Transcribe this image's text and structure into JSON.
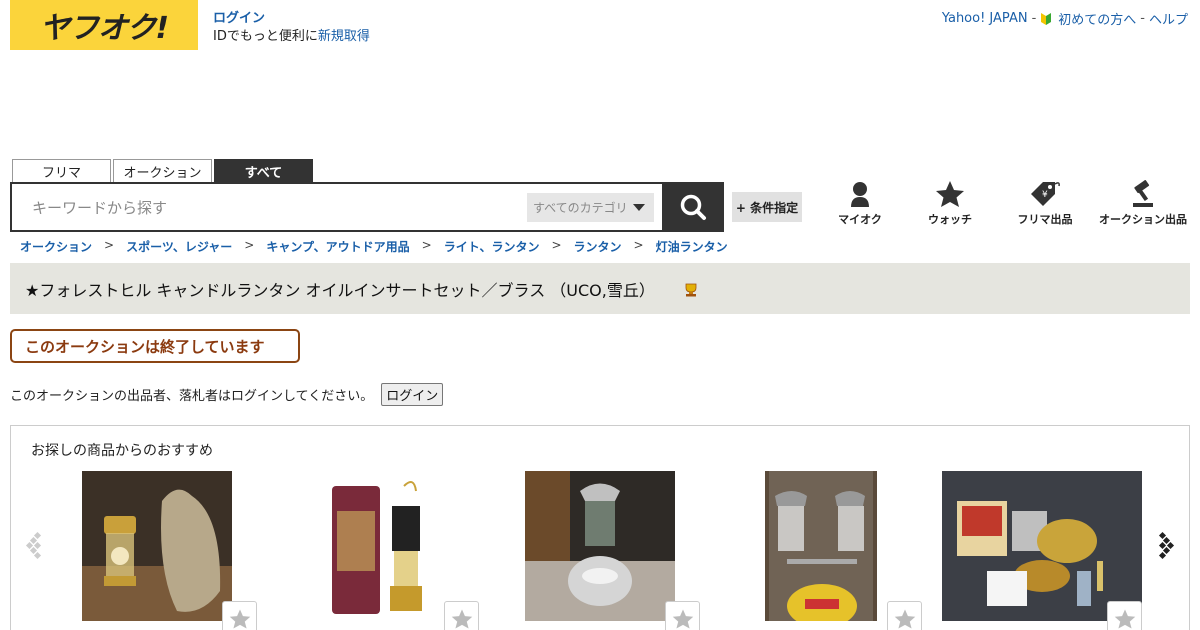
{
  "header": {
    "logo_text": "ヤフオク!",
    "login_link": "ログイン",
    "login_sub_prefix": "IDでもっと便利に",
    "signup_link": "新規取得",
    "top_links": [
      "Yahoo! JAPAN",
      "初めての方へ",
      "ヘルプ"
    ],
    "top_sep": "-"
  },
  "search": {
    "tabs": [
      "フリマ",
      "オークション",
      "すべて"
    ],
    "active_tab": "すべて",
    "placeholder": "キーワードから探す",
    "category": "すべてのカテゴリ",
    "condition_label": "+ 条件指定"
  },
  "nav": {
    "items": [
      {
        "label": "マイオク",
        "icon": "person-icon"
      },
      {
        "label": "ウォッチ",
        "icon": "star-icon"
      },
      {
        "label": "フリマ出品",
        "icon": "price-tag-icon"
      },
      {
        "label": "オークション出品",
        "icon": "gavel-icon"
      }
    ]
  },
  "breadcrumb": [
    "オークション",
    "スポーツ、レジャー",
    "キャンプ、アウトドア用品",
    "ライト、ランタン",
    "ランタン",
    "灯油ランタン"
  ],
  "breadcrumb_sep": ">",
  "item": {
    "title": "★フォレストヒル キャンドルランタン オイルインサートセット／ブラス （UCO,雪丘）"
  },
  "status": {
    "ended_text": "このオークションは終了しています",
    "login_note": "このオークションの出品者、落札者はログインしてください。",
    "login_button": "ログイン"
  },
  "recommendations": {
    "title": "お探しの商品からのおすすめ",
    "items": [
      {
        "name": "brass-candle-lantern-with-bag"
      },
      {
        "name": "miners-lamp-with-tube"
      },
      {
        "name": "silver-pressure-lantern"
      },
      {
        "name": "twin-lantern-on-gas-canister"
      },
      {
        "name": "brass-stove-set"
      }
    ]
  },
  "colors": {
    "logo_bg": "#fbd43b",
    "link": "#1a5fa8",
    "title_bar_bg": "#e5e5df",
    "ended_border": "#8b4513"
  }
}
